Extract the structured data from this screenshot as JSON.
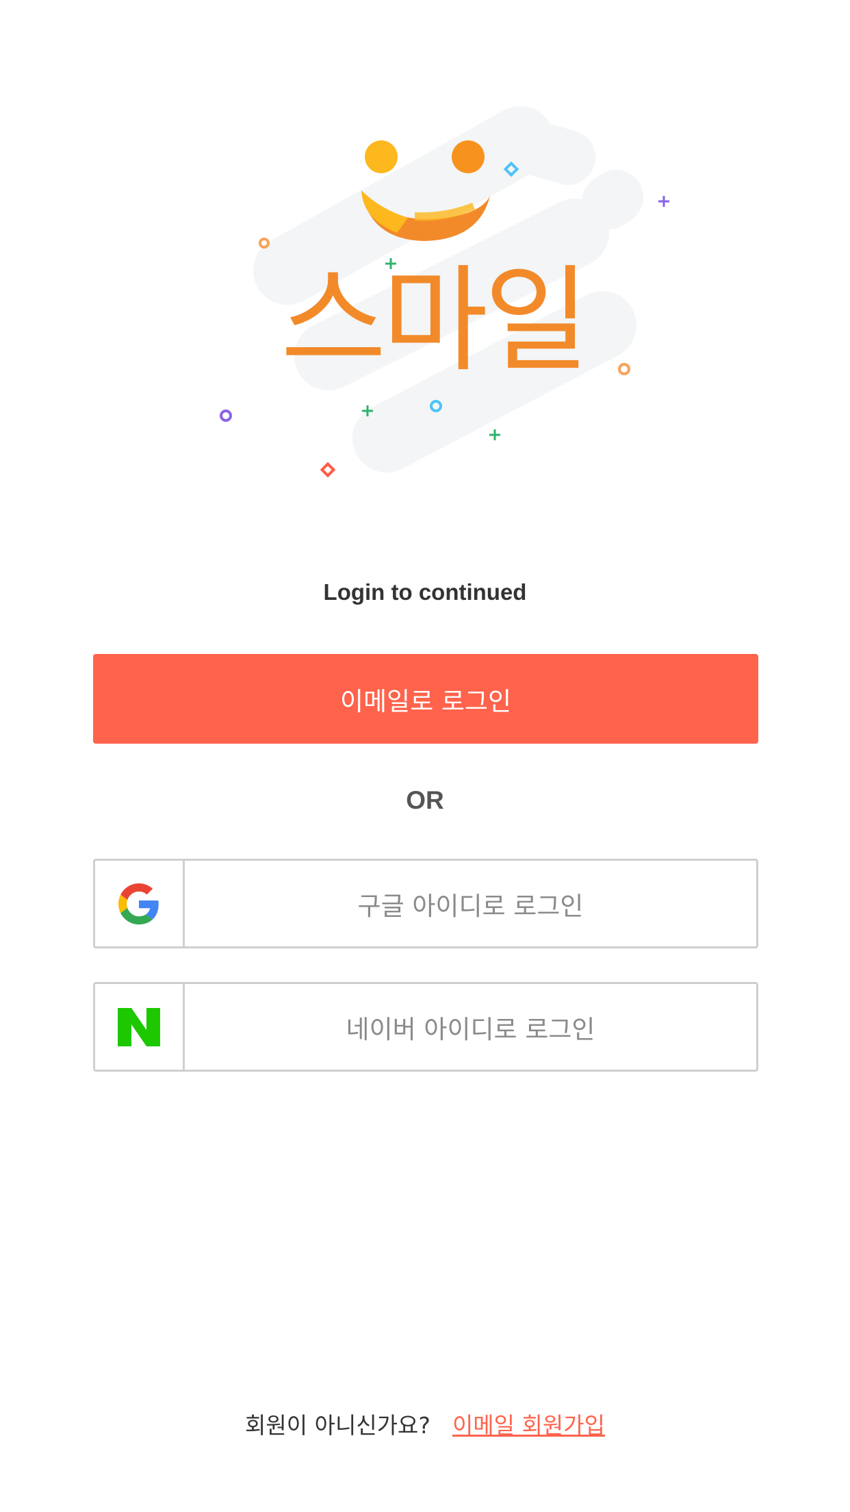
{
  "logo": {
    "text": "스마일",
    "colors": {
      "orange": "#f28a2a",
      "yellow": "#fdb81e",
      "backdrop": "#f3f5f6"
    }
  },
  "subtitle": "Login to continued",
  "email_login": {
    "label": "이메일로 로그인",
    "color": "#ff634c"
  },
  "or_text": "OR",
  "google_login": {
    "icon": "google-g-icon",
    "label": "구글 아이디로 로그인"
  },
  "naver_login": {
    "icon": "naver-n-icon",
    "label": "네이버 아이디로 로그인",
    "icon_color": "#1ec800"
  },
  "signup": {
    "question": "회원이 아니신가요?",
    "link": "이메일 회원가입"
  }
}
